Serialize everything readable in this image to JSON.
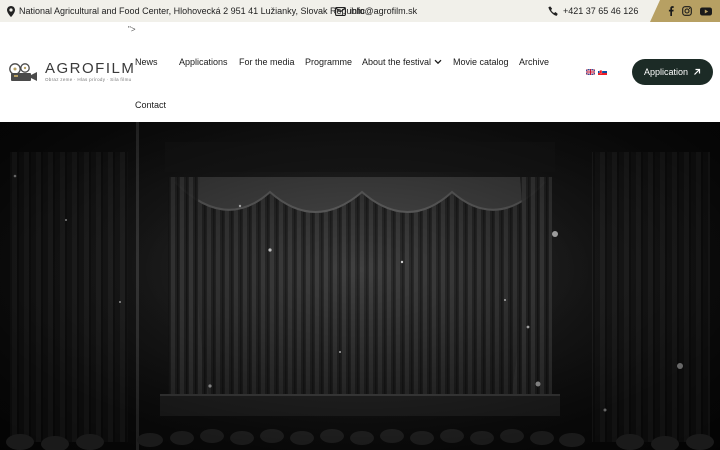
{
  "topbar": {
    "address": "National Agricultural and Food Center, Hlohovecká 2 951 41 Lužianky, Slovak Republic",
    "email": "info@agrofilm.sk",
    "phone": "+421 37 65 46 126",
    "social": [
      "facebook-icon",
      "instagram-icon",
      "youtube-icon"
    ]
  },
  "header": {
    "stray_text": "\">",
    "logo": {
      "name": "AGROFILM",
      "tagline": "Obraz zeme · Hlas prírody · Sila filmu"
    },
    "nav": [
      {
        "label": "News"
      },
      {
        "label": "Applications"
      },
      {
        "label": "For the media"
      },
      {
        "label": "Programme"
      },
      {
        "label": "About the festival"
      },
      {
        "label": "Movie catalog"
      },
      {
        "label": "Archive"
      },
      {
        "label": "Contact"
      }
    ],
    "languages": [
      "English",
      "Slovenčina"
    ],
    "cta_label": "Application"
  },
  "colors": {
    "topbar_bg": "#f1f0ea",
    "social_bg": "#b7a063",
    "cta_bg": "#1c2b26"
  }
}
